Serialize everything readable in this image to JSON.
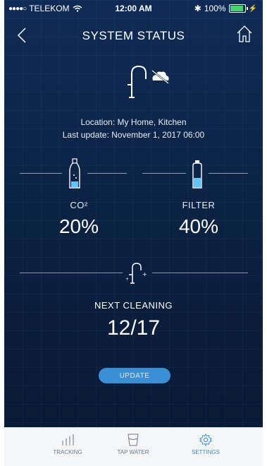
{
  "status_bar": {
    "carrier": "TELEKOM",
    "time": "12:00 AM",
    "battery": "100%"
  },
  "header": {
    "title": "SYSTEM STATUS"
  },
  "device": {
    "location": "Location: My Home, Kitchen",
    "last_update": "Last update: November 1, 2017 06:00"
  },
  "gauges": {
    "co2": {
      "label": "CO²",
      "value": "20%"
    },
    "filter": {
      "label": "FILTER",
      "value": "40%"
    }
  },
  "cleaning": {
    "label": "NEXT CLEANING",
    "value": "12/17"
  },
  "update_button": {
    "label": "UPDATE"
  },
  "tabs": [
    {
      "label": "TRACKING",
      "icon": "bar-chart-icon"
    },
    {
      "label": "TAP WATER",
      "icon": "glass-icon"
    },
    {
      "label": "SETTINGS",
      "icon": "gear-icon"
    }
  ],
  "colors": {
    "background": "#0c2447",
    "accent": "#3a8fd6",
    "battery": "#43d36e"
  }
}
